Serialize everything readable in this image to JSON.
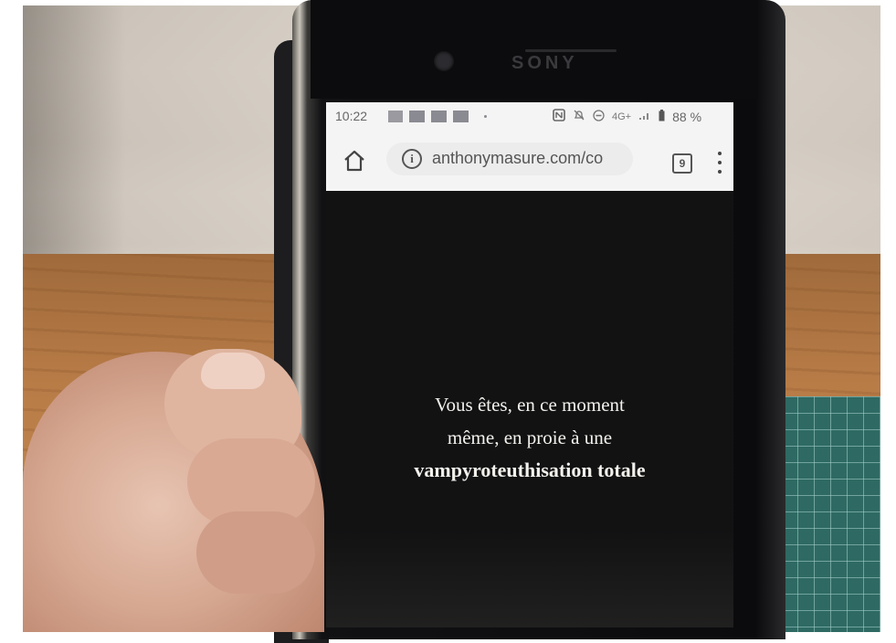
{
  "status_bar": {
    "time": "10:22",
    "battery": "88 %",
    "network": "4G+"
  },
  "browser": {
    "url": "anthonymasure.com/co",
    "tab_count": "9"
  },
  "page": {
    "line1": "Vous êtes, en ce moment",
    "line2": "même, en proie à une",
    "line3": "vampyroteuthisation totale"
  },
  "phone": {
    "brand": "SONY"
  },
  "icons": [
    "home-icon",
    "info-icon",
    "tab-switcher-icon",
    "overflow-menu-icon",
    "nfc-icon",
    "notifications-off-icon",
    "do-not-disturb-icon",
    "signal-icon",
    "battery-icon"
  ]
}
